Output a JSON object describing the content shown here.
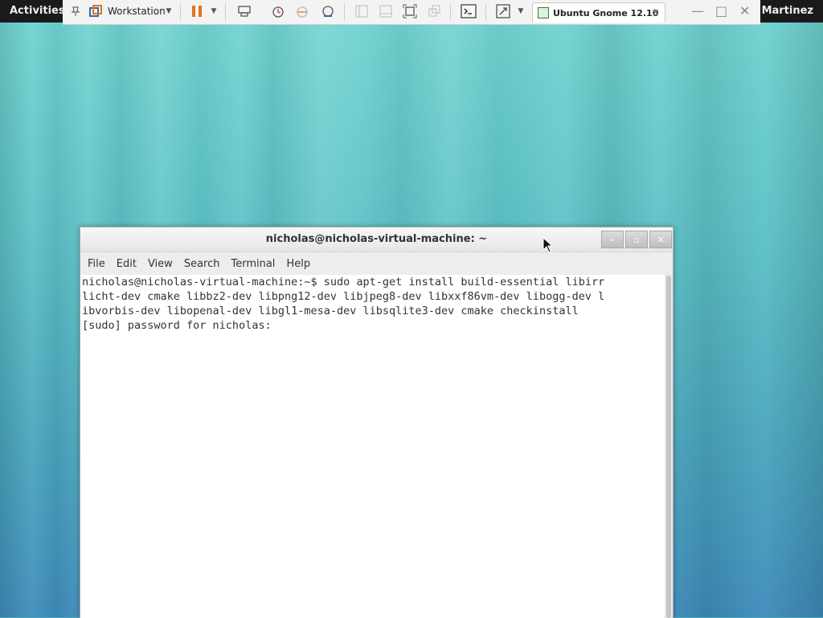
{
  "topbar": {
    "activities": "Activities",
    "user": "Martinez"
  },
  "vmware": {
    "workstation_label": "Workstation",
    "tab_title": "Ubuntu Gnome 12.10",
    "icons": [
      "pin-icon",
      "workstation-icon",
      "dropdown-icon",
      "pause-icon",
      "dropdown-icon",
      "send-keys-icon",
      "snapshot-icon",
      "revert-icon",
      "snapshot-manager-icon",
      "sidebar-icon",
      "thumbnail-icon",
      "fullscreen-icon",
      "unity-icon",
      "console-icon",
      "stretch-icon",
      "dropdown-icon"
    ]
  },
  "terminal": {
    "title": "nicholas@nicholas-virtual-machine: ~",
    "menu": [
      "File",
      "Edit",
      "View",
      "Search",
      "Terminal",
      "Help"
    ],
    "lines": [
      "nicholas@nicholas-virtual-machine:~$ sudo apt-get install build-essential libirr",
      "licht-dev cmake libbz2-dev libpng12-dev libjpeg8-dev libxxf86vm-dev libogg-dev l",
      "ibvorbis-dev libopenal-dev libgl1-mesa-dev libsqlite3-dev cmake checkinstall",
      "[sudo] password for nicholas: "
    ]
  },
  "colors": {
    "topbar": "#1a1a1a",
    "accent_pause": "#e8731a",
    "wallpaper": "#5cc2c6"
  }
}
